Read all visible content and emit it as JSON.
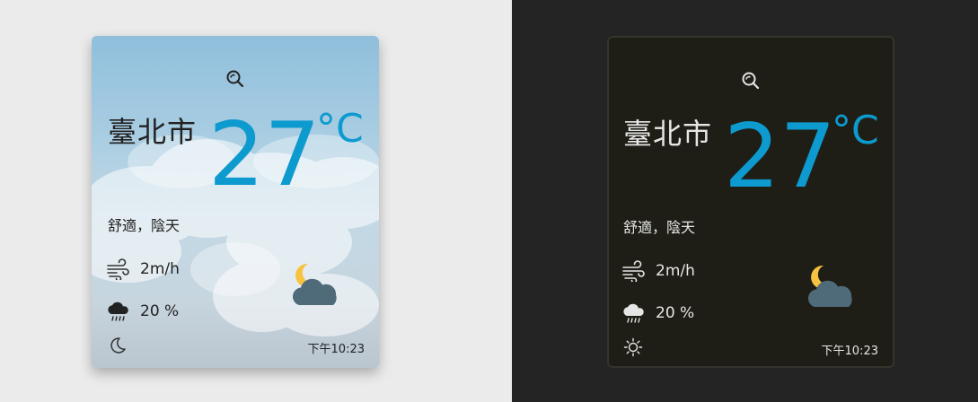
{
  "colors": {
    "temperature": "#0c9acf",
    "light_bg": "#ebebeb",
    "dark_bg": "#242424",
    "sun_moon": "#f7c23f",
    "cloud": "#4f6b7a"
  },
  "cards": [
    {
      "theme": "light",
      "search_icon": "search-icon",
      "city": "臺北市",
      "temperature": "27",
      "unit": "°C",
      "description": "舒適，陰天",
      "wind_icon": "wind-icon",
      "wind": "2m/h",
      "rain_icon": "rain-icon",
      "rain": "20 %",
      "mode_icon": "moon-icon",
      "weather_icon": "partly-cloudy-night-icon",
      "time": "下午10:23"
    },
    {
      "theme": "dark",
      "search_icon": "search-icon",
      "city": "臺北市",
      "temperature": "27",
      "unit": "°C",
      "description": "舒適，陰天",
      "wind_icon": "wind-icon",
      "wind": "2m/h",
      "rain_icon": "rain-icon",
      "rain": "20 %",
      "mode_icon": "sun-icon",
      "weather_icon": "partly-cloudy-night-icon",
      "time": "下午10:23"
    }
  ]
}
